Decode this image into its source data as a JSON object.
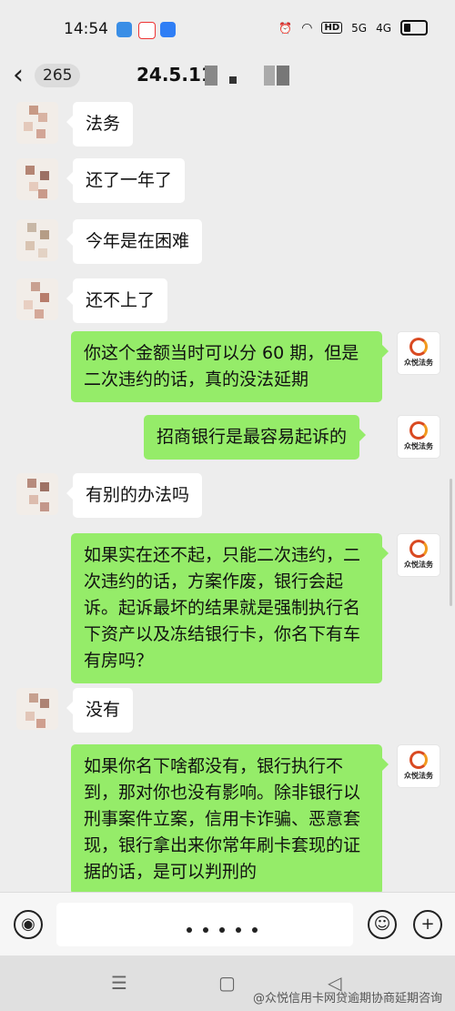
{
  "status_bar": {
    "time": "14:54",
    "hd": "HD",
    "net1": "5G",
    "net2": "4G"
  },
  "header": {
    "back_icon": "chevron-left-icon",
    "unread_count": "265",
    "title": "24.5.11"
  },
  "messages": [
    {
      "side": "in",
      "text": "法务"
    },
    {
      "side": "in",
      "text": "还了一年了"
    },
    {
      "side": "in",
      "text": "今年是在困难"
    },
    {
      "side": "in",
      "text": "还不上了"
    },
    {
      "side": "out",
      "text": "你这个金额当时可以分 60 期，但是二次违约的话，真的没法延期"
    },
    {
      "side": "out",
      "text": "招商银行是最容易起诉的"
    },
    {
      "side": "in",
      "text": "有别的办法吗"
    },
    {
      "side": "out",
      "text": "如果实在还不起，只能二次违约，二次违约的话，方案作废，银行会起诉。起诉最坏的结果就是强制执行名下资产以及冻结银行卡，你名下有车有房吗？"
    },
    {
      "side": "in",
      "text": "没有"
    },
    {
      "side": "out",
      "text": "如果你名下啥都没有，银行执行不到，那对你也没有影响。除非银行以刑事案件立案，信用卡诈骗、恶意套现，银行拿出来你常年刷卡套现的证据的话，是可以判刑的"
    }
  ],
  "agent_avatar": {
    "label": "众悦法务"
  },
  "colors": {
    "outgoing_bubble": "#95ec69",
    "incoming_bubble": "#ffffff",
    "background": "#ededed"
  },
  "watermark": "@众悦信用卡网贷逾期协商延期咨询"
}
